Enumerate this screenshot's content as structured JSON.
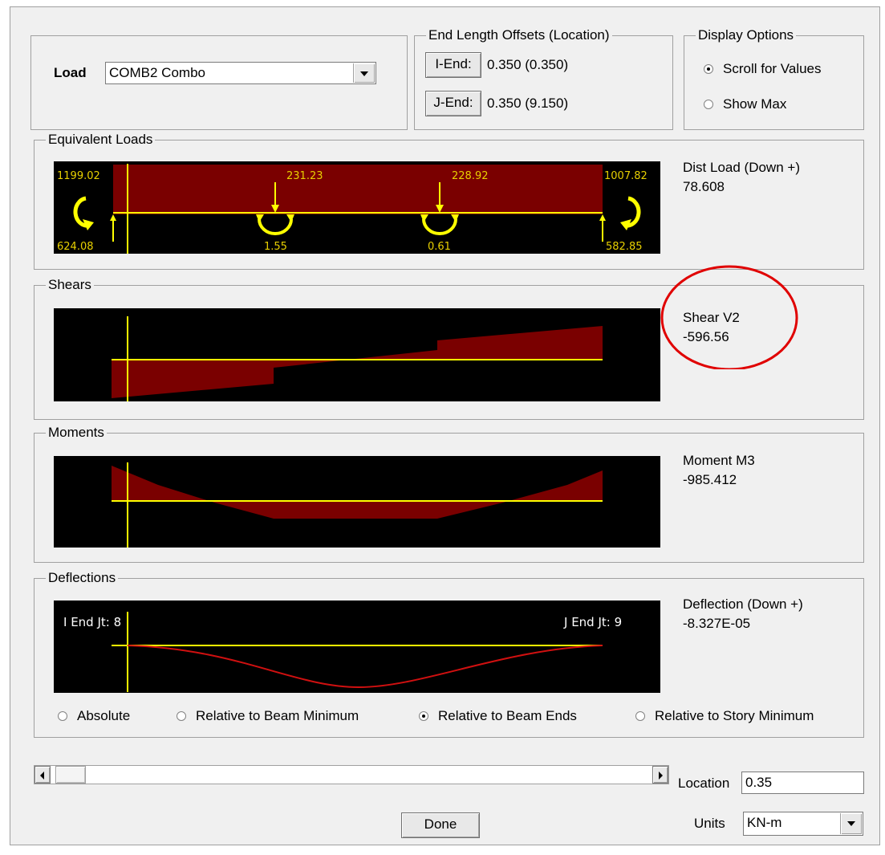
{
  "load": {
    "label": "Load",
    "selected": "COMB2 Combo"
  },
  "end_offsets": {
    "title": "End Length Offsets (Location)",
    "i_end_button": "I-End:",
    "i_end_value": "0.350  (0.350)",
    "j_end_button": "J-End:",
    "j_end_value": "0.350  (9.150)"
  },
  "display_options": {
    "title": "Display Options",
    "options": [
      "Scroll for Values",
      "Show Max"
    ],
    "selected": "Scroll for Values"
  },
  "equivalent_loads": {
    "title": "Equivalent Loads",
    "readout_label": "Dist Load (Down +)",
    "readout_value": "78.608",
    "labels": {
      "left_top": "1199.02",
      "left_bottom": "624.08",
      "p1_top": "231.23",
      "p1_bottom": "1.55",
      "p2_top": "228.92",
      "p2_bottom": "0.61",
      "right_top": "1007.82",
      "right_bottom": "582.85"
    }
  },
  "shears": {
    "title": "Shears",
    "readout_label": "Shear V2",
    "readout_value": "-596.56"
  },
  "moments": {
    "title": "Moments",
    "readout_label": "Moment M3",
    "readout_value": "-985.412"
  },
  "deflections": {
    "title": "Deflections",
    "readout_label": "Deflection (Down +)",
    "readout_value": "-8.327E-05",
    "i_end_label": "I End Jt: 8",
    "j_end_label": "J End Jt: 9",
    "options": [
      "Absolute",
      "Relative to Beam Minimum",
      "Relative to Beam Ends",
      "Relative to Story Minimum"
    ],
    "selected": "Relative to Beam Ends"
  },
  "location": {
    "label": "Location",
    "value": "0.35"
  },
  "done_button": "Done",
  "units": {
    "label": "Units",
    "selected": "KN-m"
  },
  "colors": {
    "diagram_fill": "#7a0000",
    "axis_line": "#ffff00",
    "label_text": "#e8d000",
    "annotation_circle": "#e00000"
  }
}
